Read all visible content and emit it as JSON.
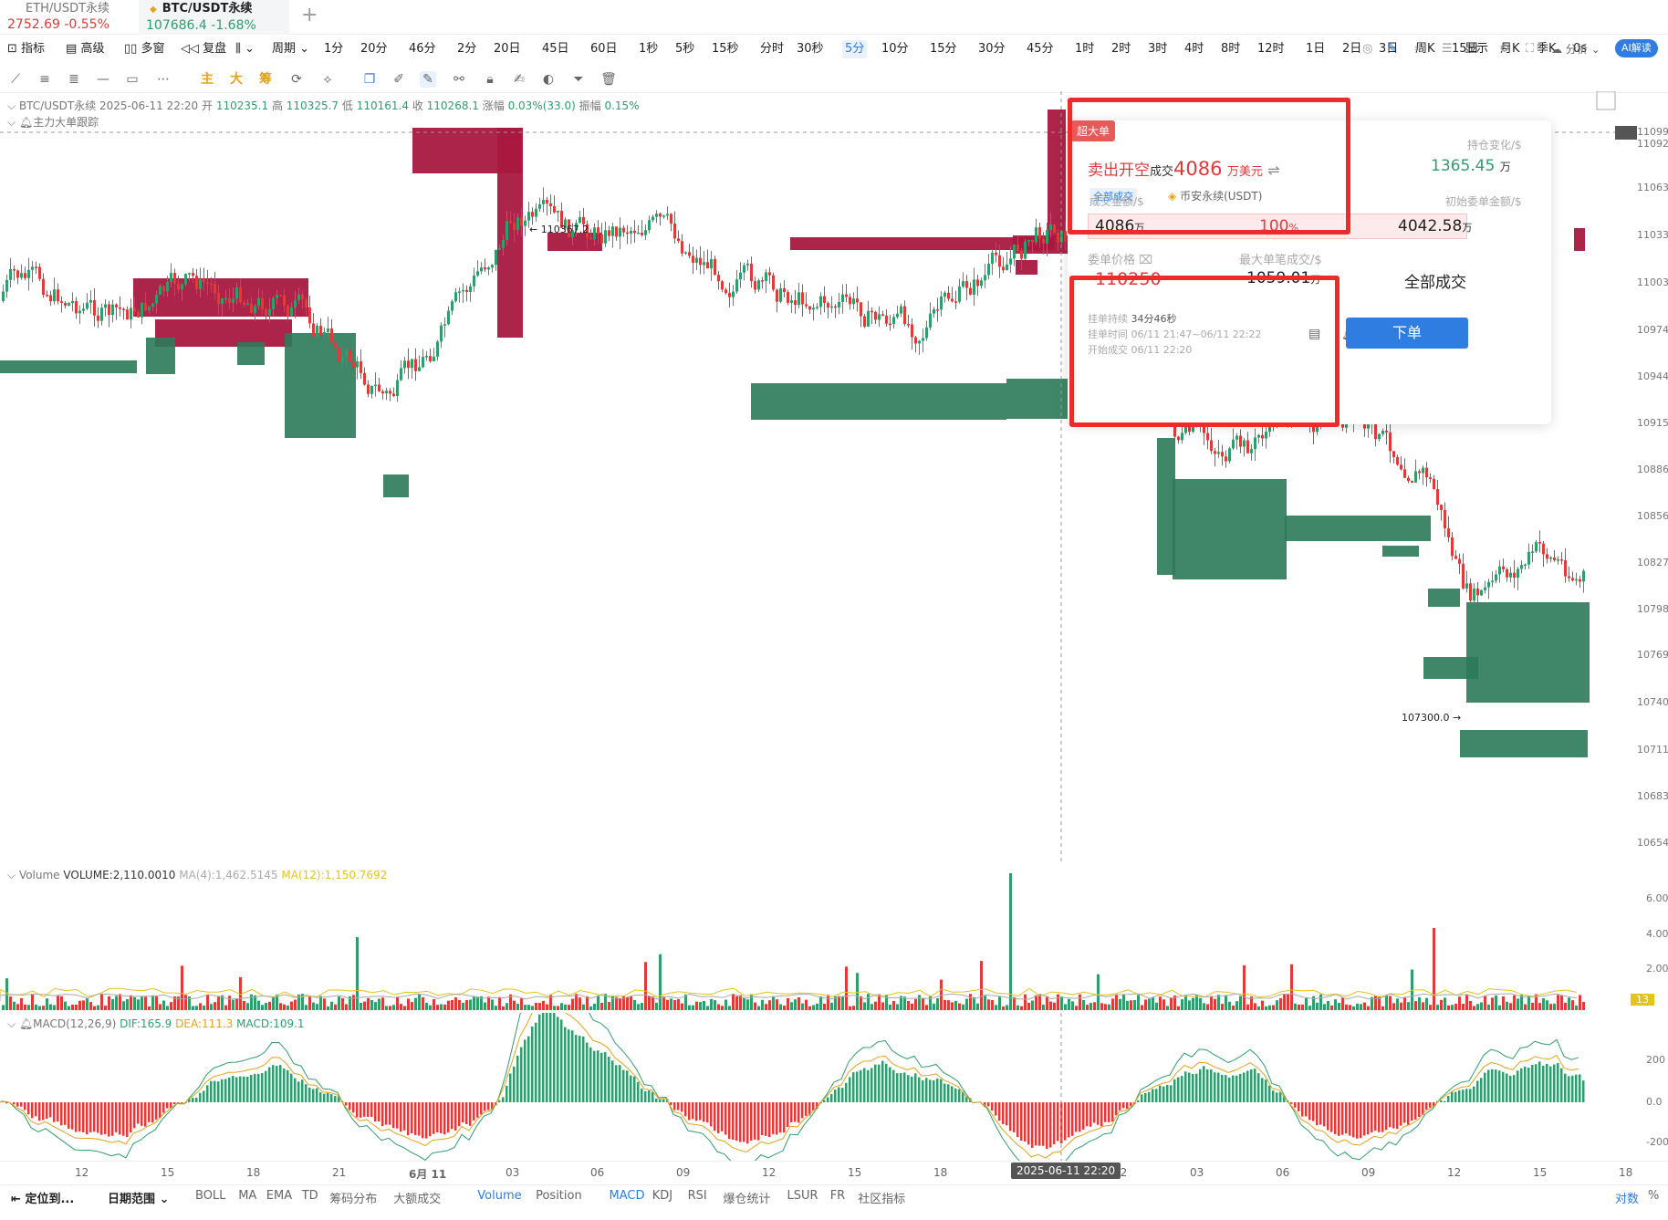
{
  "tabs": [
    {
      "name": "ETH/USDT永续",
      "price": "2752.69",
      "change": "-0.55%",
      "dir": "dn"
    },
    {
      "name": "BTC/USDT永续",
      "price": "107686.4",
      "change": "-1.68%",
      "dir": "up"
    }
  ],
  "toolbar1": {
    "indicators": "指标",
    "advanced": "高级",
    "multi": "多窗",
    "replay": "复盘",
    "period": "周期",
    "periods": [
      "1分",
      "20分",
      "46分",
      "2分",
      "20日",
      "45日",
      "60日",
      "1秒",
      "5秒",
      "15秒",
      "分时",
      "30秒",
      "5分",
      "10分",
      "15分",
      "30分",
      "45分",
      "1时",
      "2时",
      "3时",
      "4时",
      "8时",
      "12时",
      "1日",
      "2日",
      "3日",
      "周K",
      "15日",
      "月K",
      "季K",
      "0s"
    ],
    "selected_period": "5分",
    "display": "显示",
    "analysis": "分析",
    "ai": "AI解读"
  },
  "toolbar2": {
    "main": "主",
    "big": "大",
    "chips": "筹"
  },
  "info": {
    "symbol": "BTC/USDT永续",
    "time": "2025-06-11 22:20",
    "open_label": "开",
    "open": "110235.1",
    "high_label": "高",
    "high": "110325.7",
    "low_label": "低",
    "low": "110161.4",
    "close_label": "收",
    "close": "110268.1",
    "change_label": "涨幅",
    "change": "0.03%(33.0)",
    "amp_label": "振幅",
    "amp": "0.15%",
    "sub": "主力大单跟踪"
  },
  "chart_annotations": {
    "high_mark": "← 110367.2",
    "low_mark": "107300.0 →"
  },
  "price_axis": [
    "11099",
    "11092",
    "11063",
    "11033",
    "11003",
    "10974",
    "10944",
    "10915",
    "10886",
    "10856",
    "10827",
    "10798",
    "10769",
    "10740",
    "10711",
    "10683",
    "10654"
  ],
  "volume_legend": {
    "name": "Volume",
    "vol": "VOLUME:2,110.0010",
    "ma4": "MA(4):1,462.5145",
    "ma12": "MA(12):1,150.7692"
  },
  "volume_axis": [
    "6.00",
    "4.00",
    "2.00",
    "13"
  ],
  "macd_legend": {
    "name": "MACD(12,26,9)",
    "dif": "DIF:165.9",
    "dea": "DEA:111.3",
    "macd": "MACD:109.1"
  },
  "macd_axis": [
    "200",
    "0.0",
    "-200"
  ],
  "x_axis": [
    "12",
    "15",
    "18",
    "21",
    "6月 11",
    "03",
    "06",
    "09",
    "12",
    "15",
    "18",
    "12",
    "03",
    "06",
    "09",
    "12",
    "15",
    "18"
  ],
  "cursor_time": "2025-06-11 22:20",
  "bottom": {
    "locate": "定位到...",
    "range": "日期范围",
    "inds": [
      "BOLL",
      "MA",
      "EMA",
      "TD",
      "筹码分布",
      "大额成交",
      "Volume",
      "Position",
      "MACD",
      "KDJ",
      "RSI",
      "爆仓统计",
      "LSUR",
      "FR",
      "社区指标"
    ],
    "active": [
      "Volume",
      "MACD"
    ],
    "log": "对数",
    "pct": "%"
  },
  "popup": {
    "badge": "超大单",
    "side": "卖出开空",
    "deal": "成交",
    "amount": "4086",
    "unit": "万美元",
    "all_deal": "全部成交",
    "exchange": "币安永续(USDT)",
    "oi_change_label": "持仓变化/$",
    "oi_change": "1365.45",
    "oi_unit": "万",
    "fill_label": "成交金额/$",
    "init_label": "初始委单金额/$",
    "fill": "4086",
    "fill_unit": "万",
    "fill_pct": "100",
    "pct": "%",
    "init": "4042.58",
    "init_unit": "万",
    "price_label": "委单价格",
    "max_label": "最大单笔成交/$",
    "price": "110250",
    "max": "1059.01",
    "max_unit": "万",
    "status": "全部成交",
    "dur_label": "挂单持续",
    "dur": "34分46秒",
    "time_label": "挂单时间",
    "time": "06/11 21:47~06/11 22:22",
    "start_label": "开始成交",
    "start": "06/11 22:20",
    "order": "下单"
  },
  "colors": {
    "up": "#2e9e6d",
    "down": "#e03a3a",
    "sell_block": "#a8183f",
    "buy_block": "#2b7a5a",
    "accent": "#2f7de1"
  }
}
